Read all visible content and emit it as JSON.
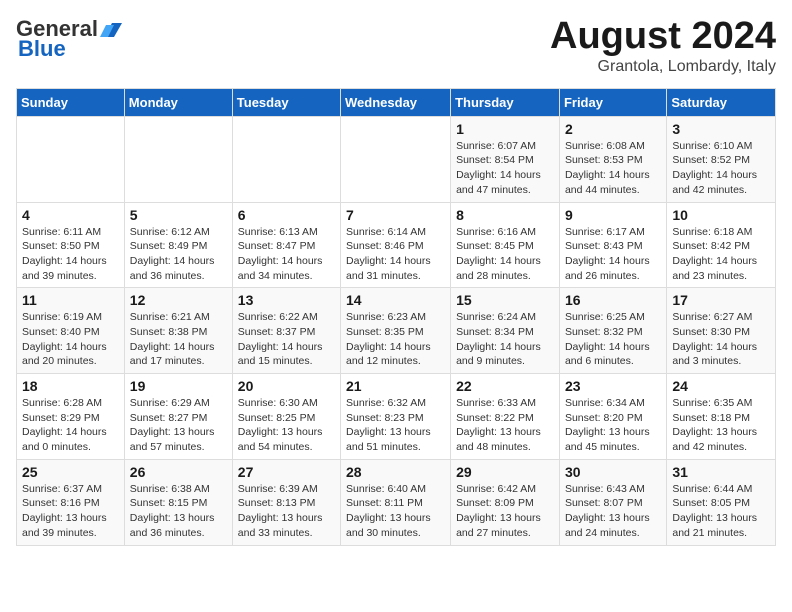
{
  "header": {
    "logo_general": "General",
    "logo_blue": "Blue",
    "month_title": "August 2024",
    "location": "Grantola, Lombardy, Italy"
  },
  "weekdays": [
    "Sunday",
    "Monday",
    "Tuesday",
    "Wednesday",
    "Thursday",
    "Friday",
    "Saturday"
  ],
  "weeks": [
    [
      {
        "day": "",
        "detail": ""
      },
      {
        "day": "",
        "detail": ""
      },
      {
        "day": "",
        "detail": ""
      },
      {
        "day": "",
        "detail": ""
      },
      {
        "day": "1",
        "detail": "Sunrise: 6:07 AM\nSunset: 8:54 PM\nDaylight: 14 hours and 47 minutes."
      },
      {
        "day": "2",
        "detail": "Sunrise: 6:08 AM\nSunset: 8:53 PM\nDaylight: 14 hours and 44 minutes."
      },
      {
        "day": "3",
        "detail": "Sunrise: 6:10 AM\nSunset: 8:52 PM\nDaylight: 14 hours and 42 minutes."
      }
    ],
    [
      {
        "day": "4",
        "detail": "Sunrise: 6:11 AM\nSunset: 8:50 PM\nDaylight: 14 hours and 39 minutes."
      },
      {
        "day": "5",
        "detail": "Sunrise: 6:12 AM\nSunset: 8:49 PM\nDaylight: 14 hours and 36 minutes."
      },
      {
        "day": "6",
        "detail": "Sunrise: 6:13 AM\nSunset: 8:47 PM\nDaylight: 14 hours and 34 minutes."
      },
      {
        "day": "7",
        "detail": "Sunrise: 6:14 AM\nSunset: 8:46 PM\nDaylight: 14 hours and 31 minutes."
      },
      {
        "day": "8",
        "detail": "Sunrise: 6:16 AM\nSunset: 8:45 PM\nDaylight: 14 hours and 28 minutes."
      },
      {
        "day": "9",
        "detail": "Sunrise: 6:17 AM\nSunset: 8:43 PM\nDaylight: 14 hours and 26 minutes."
      },
      {
        "day": "10",
        "detail": "Sunrise: 6:18 AM\nSunset: 8:42 PM\nDaylight: 14 hours and 23 minutes."
      }
    ],
    [
      {
        "day": "11",
        "detail": "Sunrise: 6:19 AM\nSunset: 8:40 PM\nDaylight: 14 hours and 20 minutes."
      },
      {
        "day": "12",
        "detail": "Sunrise: 6:21 AM\nSunset: 8:38 PM\nDaylight: 14 hours and 17 minutes."
      },
      {
        "day": "13",
        "detail": "Sunrise: 6:22 AM\nSunset: 8:37 PM\nDaylight: 14 hours and 15 minutes."
      },
      {
        "day": "14",
        "detail": "Sunrise: 6:23 AM\nSunset: 8:35 PM\nDaylight: 14 hours and 12 minutes."
      },
      {
        "day": "15",
        "detail": "Sunrise: 6:24 AM\nSunset: 8:34 PM\nDaylight: 14 hours and 9 minutes."
      },
      {
        "day": "16",
        "detail": "Sunrise: 6:25 AM\nSunset: 8:32 PM\nDaylight: 14 hours and 6 minutes."
      },
      {
        "day": "17",
        "detail": "Sunrise: 6:27 AM\nSunset: 8:30 PM\nDaylight: 14 hours and 3 minutes."
      }
    ],
    [
      {
        "day": "18",
        "detail": "Sunrise: 6:28 AM\nSunset: 8:29 PM\nDaylight: 14 hours and 0 minutes."
      },
      {
        "day": "19",
        "detail": "Sunrise: 6:29 AM\nSunset: 8:27 PM\nDaylight: 13 hours and 57 minutes."
      },
      {
        "day": "20",
        "detail": "Sunrise: 6:30 AM\nSunset: 8:25 PM\nDaylight: 13 hours and 54 minutes."
      },
      {
        "day": "21",
        "detail": "Sunrise: 6:32 AM\nSunset: 8:23 PM\nDaylight: 13 hours and 51 minutes."
      },
      {
        "day": "22",
        "detail": "Sunrise: 6:33 AM\nSunset: 8:22 PM\nDaylight: 13 hours and 48 minutes."
      },
      {
        "day": "23",
        "detail": "Sunrise: 6:34 AM\nSunset: 8:20 PM\nDaylight: 13 hours and 45 minutes."
      },
      {
        "day": "24",
        "detail": "Sunrise: 6:35 AM\nSunset: 8:18 PM\nDaylight: 13 hours and 42 minutes."
      }
    ],
    [
      {
        "day": "25",
        "detail": "Sunrise: 6:37 AM\nSunset: 8:16 PM\nDaylight: 13 hours and 39 minutes."
      },
      {
        "day": "26",
        "detail": "Sunrise: 6:38 AM\nSunset: 8:15 PM\nDaylight: 13 hours and 36 minutes."
      },
      {
        "day": "27",
        "detail": "Sunrise: 6:39 AM\nSunset: 8:13 PM\nDaylight: 13 hours and 33 minutes."
      },
      {
        "day": "28",
        "detail": "Sunrise: 6:40 AM\nSunset: 8:11 PM\nDaylight: 13 hours and 30 minutes."
      },
      {
        "day": "29",
        "detail": "Sunrise: 6:42 AM\nSunset: 8:09 PM\nDaylight: 13 hours and 27 minutes."
      },
      {
        "day": "30",
        "detail": "Sunrise: 6:43 AM\nSunset: 8:07 PM\nDaylight: 13 hours and 24 minutes."
      },
      {
        "day": "31",
        "detail": "Sunrise: 6:44 AM\nSunset: 8:05 PM\nDaylight: 13 hours and 21 minutes."
      }
    ]
  ]
}
